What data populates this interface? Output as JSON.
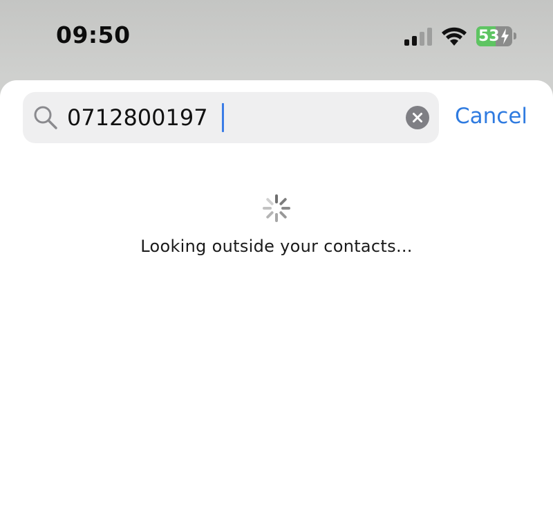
{
  "status_bar": {
    "time": "09:50",
    "signal_icon": "cellular-signal-icon",
    "wifi_icon": "wifi-icon",
    "battery": {
      "level": "53",
      "level_fraction": 0.53,
      "charging": true,
      "fill_color": "#5ec462"
    }
  },
  "search": {
    "icon": "search-icon",
    "value": "0712800197",
    "clear_icon": "clear-icon",
    "cancel_label": "Cancel",
    "accent_color": "#2f7be0"
  },
  "results": {
    "loading_icon": "spinner-icon",
    "message": "Looking outside your contacts..."
  }
}
